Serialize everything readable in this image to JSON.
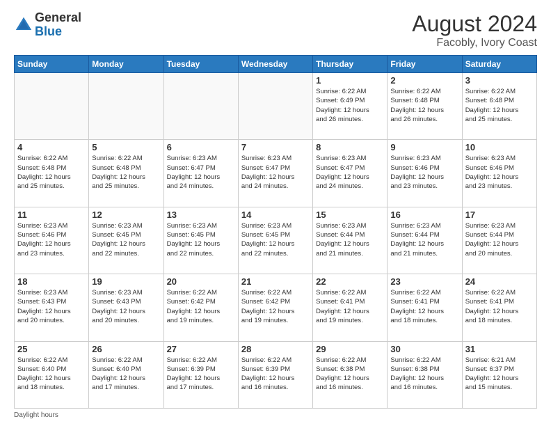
{
  "logo": {
    "general": "General",
    "blue": "Blue"
  },
  "header": {
    "month_year": "August 2024",
    "location": "Facobly, Ivory Coast"
  },
  "days_of_week": [
    "Sunday",
    "Monday",
    "Tuesday",
    "Wednesday",
    "Thursday",
    "Friday",
    "Saturday"
  ],
  "weeks": [
    [
      {
        "day": "",
        "info": ""
      },
      {
        "day": "",
        "info": ""
      },
      {
        "day": "",
        "info": ""
      },
      {
        "day": "",
        "info": ""
      },
      {
        "day": "1",
        "info": "Sunrise: 6:22 AM\nSunset: 6:49 PM\nDaylight: 12 hours\nand 26 minutes."
      },
      {
        "day": "2",
        "info": "Sunrise: 6:22 AM\nSunset: 6:48 PM\nDaylight: 12 hours\nand 26 minutes."
      },
      {
        "day": "3",
        "info": "Sunrise: 6:22 AM\nSunset: 6:48 PM\nDaylight: 12 hours\nand 25 minutes."
      }
    ],
    [
      {
        "day": "4",
        "info": "Sunrise: 6:22 AM\nSunset: 6:48 PM\nDaylight: 12 hours\nand 25 minutes."
      },
      {
        "day": "5",
        "info": "Sunrise: 6:22 AM\nSunset: 6:48 PM\nDaylight: 12 hours\nand 25 minutes."
      },
      {
        "day": "6",
        "info": "Sunrise: 6:23 AM\nSunset: 6:47 PM\nDaylight: 12 hours\nand 24 minutes."
      },
      {
        "day": "7",
        "info": "Sunrise: 6:23 AM\nSunset: 6:47 PM\nDaylight: 12 hours\nand 24 minutes."
      },
      {
        "day": "8",
        "info": "Sunrise: 6:23 AM\nSunset: 6:47 PM\nDaylight: 12 hours\nand 24 minutes."
      },
      {
        "day": "9",
        "info": "Sunrise: 6:23 AM\nSunset: 6:46 PM\nDaylight: 12 hours\nand 23 minutes."
      },
      {
        "day": "10",
        "info": "Sunrise: 6:23 AM\nSunset: 6:46 PM\nDaylight: 12 hours\nand 23 minutes."
      }
    ],
    [
      {
        "day": "11",
        "info": "Sunrise: 6:23 AM\nSunset: 6:46 PM\nDaylight: 12 hours\nand 23 minutes."
      },
      {
        "day": "12",
        "info": "Sunrise: 6:23 AM\nSunset: 6:45 PM\nDaylight: 12 hours\nand 22 minutes."
      },
      {
        "day": "13",
        "info": "Sunrise: 6:23 AM\nSunset: 6:45 PM\nDaylight: 12 hours\nand 22 minutes."
      },
      {
        "day": "14",
        "info": "Sunrise: 6:23 AM\nSunset: 6:45 PM\nDaylight: 12 hours\nand 22 minutes."
      },
      {
        "day": "15",
        "info": "Sunrise: 6:23 AM\nSunset: 6:44 PM\nDaylight: 12 hours\nand 21 minutes."
      },
      {
        "day": "16",
        "info": "Sunrise: 6:23 AM\nSunset: 6:44 PM\nDaylight: 12 hours\nand 21 minutes."
      },
      {
        "day": "17",
        "info": "Sunrise: 6:23 AM\nSunset: 6:44 PM\nDaylight: 12 hours\nand 20 minutes."
      }
    ],
    [
      {
        "day": "18",
        "info": "Sunrise: 6:23 AM\nSunset: 6:43 PM\nDaylight: 12 hours\nand 20 minutes."
      },
      {
        "day": "19",
        "info": "Sunrise: 6:23 AM\nSunset: 6:43 PM\nDaylight: 12 hours\nand 20 minutes."
      },
      {
        "day": "20",
        "info": "Sunrise: 6:22 AM\nSunset: 6:42 PM\nDaylight: 12 hours\nand 19 minutes."
      },
      {
        "day": "21",
        "info": "Sunrise: 6:22 AM\nSunset: 6:42 PM\nDaylight: 12 hours\nand 19 minutes."
      },
      {
        "day": "22",
        "info": "Sunrise: 6:22 AM\nSunset: 6:41 PM\nDaylight: 12 hours\nand 19 minutes."
      },
      {
        "day": "23",
        "info": "Sunrise: 6:22 AM\nSunset: 6:41 PM\nDaylight: 12 hours\nand 18 minutes."
      },
      {
        "day": "24",
        "info": "Sunrise: 6:22 AM\nSunset: 6:41 PM\nDaylight: 12 hours\nand 18 minutes."
      }
    ],
    [
      {
        "day": "25",
        "info": "Sunrise: 6:22 AM\nSunset: 6:40 PM\nDaylight: 12 hours\nand 18 minutes."
      },
      {
        "day": "26",
        "info": "Sunrise: 6:22 AM\nSunset: 6:40 PM\nDaylight: 12 hours\nand 17 minutes."
      },
      {
        "day": "27",
        "info": "Sunrise: 6:22 AM\nSunset: 6:39 PM\nDaylight: 12 hours\nand 17 minutes."
      },
      {
        "day": "28",
        "info": "Sunrise: 6:22 AM\nSunset: 6:39 PM\nDaylight: 12 hours\nand 16 minutes."
      },
      {
        "day": "29",
        "info": "Sunrise: 6:22 AM\nSunset: 6:38 PM\nDaylight: 12 hours\nand 16 minutes."
      },
      {
        "day": "30",
        "info": "Sunrise: 6:22 AM\nSunset: 6:38 PM\nDaylight: 12 hours\nand 16 minutes."
      },
      {
        "day": "31",
        "info": "Sunrise: 6:21 AM\nSunset: 6:37 PM\nDaylight: 12 hours\nand 15 minutes."
      }
    ]
  ],
  "footer": {
    "text": "Daylight hours"
  }
}
